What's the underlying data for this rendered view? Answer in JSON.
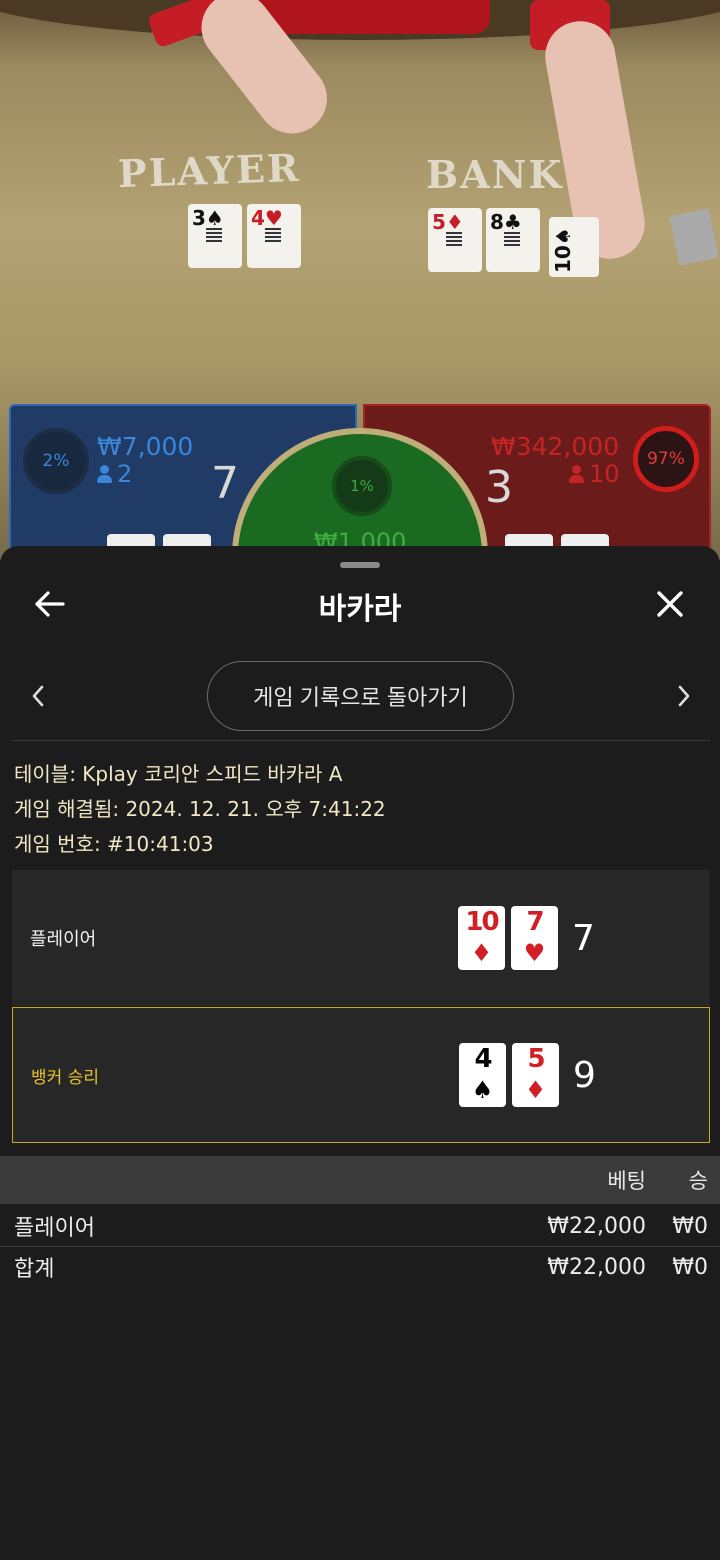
{
  "video": {
    "table_labels": {
      "player": "PLAYER",
      "banker": "BANK"
    },
    "player_cards": [
      {
        "rank": "3",
        "suit": "♠",
        "color": "black"
      },
      {
        "rank": "4",
        "suit": "♥",
        "color": "red"
      }
    ],
    "banker_cards": [
      {
        "rank": "5",
        "suit": "♦",
        "color": "red"
      },
      {
        "rank": "8",
        "suit": "♣",
        "color": "black"
      },
      {
        "rank": "10",
        "suit": "♠",
        "color": "black"
      }
    ]
  },
  "bet_panel": {
    "player": {
      "percent": "2%",
      "amount": "₩7,000",
      "players": "2",
      "score": "7",
      "color": "#3b86d8"
    },
    "tie": {
      "percent": "1%",
      "amount": "₩1,000",
      "color": "#3fae42"
    },
    "banker": {
      "percent": "97%",
      "amount": "₩342,000",
      "players": "10",
      "score": "3",
      "color": "#c52424"
    }
  },
  "sheet": {
    "title": "바카라",
    "back_icon": "arrow-left-icon",
    "close_icon": "close-icon",
    "history_button": "게임 기록으로 돌아가기",
    "info": {
      "table": "테이블: Kplay 코리안 스피드 바카라 A",
      "resolved": "게임 해결됨: 2024. 12. 21. 오후 7:41:22",
      "game_number": "게임 번호: #10:41:03"
    },
    "hands": [
      {
        "label": "플레이어",
        "winner": false,
        "total": "7",
        "cards": [
          {
            "rank": "10",
            "suit": "♦",
            "color": "red"
          },
          {
            "rank": "7",
            "suit": "♥",
            "color": "red"
          }
        ]
      },
      {
        "label": "뱅커 승리",
        "winner": true,
        "total": "9",
        "cards": [
          {
            "rank": "4",
            "suit": "♠",
            "color": "black"
          },
          {
            "rank": "5",
            "suit": "♦",
            "color": "red"
          }
        ]
      }
    ],
    "bets_table": {
      "headers": {
        "bet": "베팅",
        "win": "승"
      },
      "rows": [
        {
          "name": "플레이어",
          "bet": "₩22,000",
          "win": "₩0"
        }
      ],
      "total": {
        "name": "합계",
        "bet": "₩22,000",
        "win": "₩0"
      }
    },
    "accent_color": "#e8c12c"
  }
}
